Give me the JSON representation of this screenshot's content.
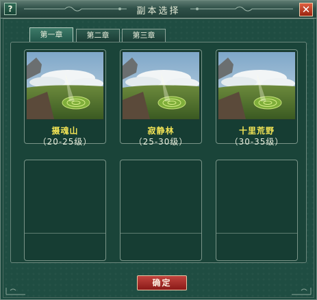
{
  "window": {
    "title": "副本选择",
    "help_label": "?",
    "close_label": "✕"
  },
  "tabs": [
    {
      "label": "第一章",
      "active": true
    },
    {
      "label": "第二章",
      "active": false
    },
    {
      "label": "第三章",
      "active": false
    }
  ],
  "dungeons": [
    {
      "name": "摄魂山",
      "level": "（20-25级）"
    },
    {
      "name": "寂静林",
      "level": "（25-30级）"
    },
    {
      "name": "十里荒野",
      "level": "（30-35级）"
    }
  ],
  "confirm_label": "确定",
  "colors": {
    "panel_bg": "#1f4d42",
    "name_yellow": "#f3e455",
    "confirm_red": "#a82a26"
  }
}
